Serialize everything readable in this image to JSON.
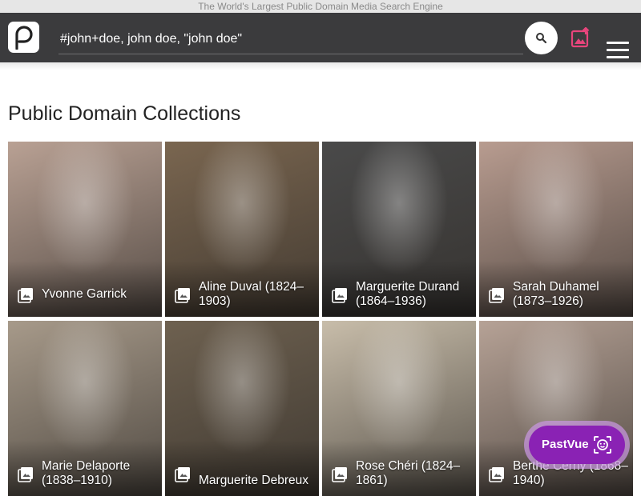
{
  "tagline": "The World's Largest Public Domain Media Search Engine",
  "search": {
    "value": "#john+doe, john doe, \"john doe\""
  },
  "section_title": "Public Domain Collections",
  "collections": [
    {
      "label": "Yvonne Garrick",
      "tone": "#b9a194"
    },
    {
      "label": "Aline Duval (1824–1903)",
      "tone": "#7a6650"
    },
    {
      "label": "Marguerite Durand (1864–1936)",
      "tone": "#4a4a4a"
    },
    {
      "label": "Sarah Duhamel (1873–1926)",
      "tone": "#b89c90"
    },
    {
      "label": "Marie Delaporte (1838–1910)",
      "tone": "#a79a8a"
    },
    {
      "label": "Marguerite Debreux",
      "tone": "#6e6150"
    },
    {
      "label": "Rose Chéri (1824–1861)",
      "tone": "#c8bdaa"
    },
    {
      "label": "Berthe Cerny (1868–1940)",
      "tone": "#b6a296"
    }
  ],
  "pastvue": {
    "label": "PastVue"
  },
  "colors": {
    "header": "#3b3b3d",
    "upload_icon": "#e8457c",
    "pastvue": "#8a22b4"
  }
}
